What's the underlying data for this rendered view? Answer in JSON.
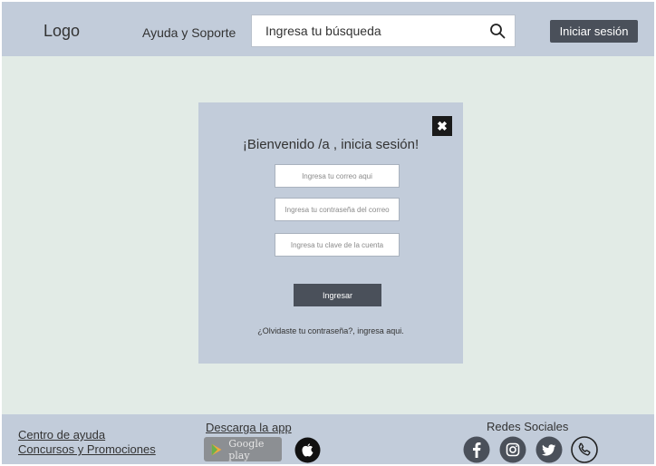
{
  "header": {
    "logo": "Logo",
    "help_link": "Ayuda y Soporte",
    "search_value": "Ingresa tu búsqueda",
    "login_button": "Iniciar sesión"
  },
  "modal": {
    "title": "¡Bienvenido /a , inicia sesión!",
    "close_label": "✖",
    "email_placeholder": "Ingresa tu correo aqui",
    "password_placeholder": "Ingresa tu contraseña del correo",
    "account_key_placeholder": "Ingresa tu clave de la cuenta",
    "submit_button": "Ingresar",
    "forgot_text": "¿Olvidaste tu contraseña?, ingresa aqui."
  },
  "footer": {
    "help_center": "Centro de ayuda",
    "promotions": "Concursos y Promociones",
    "app_title": "Descarga la app",
    "google_play": "Google play",
    "social_title": "Redes Sociales"
  },
  "colors": {
    "header_bg": "#c2ccda",
    "page_bg": "#e2ebe6",
    "button_bg": "#4a505a"
  },
  "icons": [
    "search-icon",
    "close-icon",
    "google-play-icon",
    "apple-icon",
    "facebook-icon",
    "instagram-icon",
    "twitter-icon",
    "phone-icon"
  ]
}
